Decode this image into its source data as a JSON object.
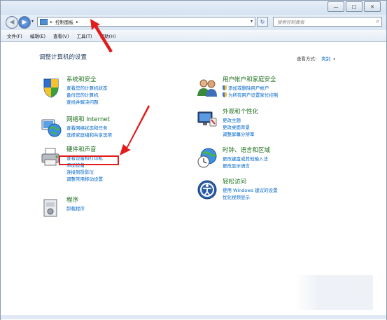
{
  "window": {
    "minimize_label": "—",
    "maximize_label": "□",
    "close_label": "✕"
  },
  "navigation": {
    "back_arrow": "◀",
    "forward_arrow": "▶",
    "dropdown": "▾",
    "breadcrumb_separator_1": "▸",
    "breadcrumb": "控制面板",
    "breadcrumb_separator_2": "▸",
    "address_dropdown": "▾",
    "refresh_glyph": "↻",
    "search_placeholder": "搜索控制面板",
    "search_glyph": "⌕"
  },
  "menubar": {
    "items": [
      "文件(F)",
      "编辑(E)",
      "查看(V)",
      "工具(T)",
      "帮助(H)"
    ]
  },
  "content": {
    "heading": "调整计算机的设置",
    "view_by_label": "查看方式:",
    "view_by_value": "类别",
    "view_by_dropdown": "▾"
  },
  "categories": {
    "system": {
      "title": "系统和安全",
      "links": [
        "查看您的计算机状态",
        "备份您的计算机",
        "查找并解决问题"
      ]
    },
    "network": {
      "title": "网络和 Internet",
      "links": [
        "查看网络状态和任务",
        "选择家庭组和共享选项"
      ]
    },
    "hardware": {
      "title": "硬件和声音",
      "links": [
        "查看设备和打印机",
        "添加设备",
        "连接到投影仪",
        "调整常用移动设置"
      ]
    },
    "programs": {
      "title": "程序",
      "links": [
        "卸载程序"
      ]
    },
    "user_accounts": {
      "title": "用户帐户和家庭安全",
      "links": [
        "添加或删除用户帐户",
        "为所有用户设置家长控制"
      ]
    },
    "appearance": {
      "title": "外观和个性化",
      "links": [
        "更改主题",
        "更改桌面背景",
        "调整屏幕分辨率"
      ]
    },
    "clock": {
      "title": "时钟、语言和区域",
      "links": [
        "更改键盘或其他输入法",
        "更改显示语言"
      ]
    },
    "ease": {
      "title": "轻松访问",
      "links": [
        "使用 Windows 建议的设置",
        "优化视频显示"
      ]
    }
  },
  "colors": {
    "category_title": "#1d6e1d",
    "link": "#0066cc",
    "annotation": "#e21b1b"
  }
}
